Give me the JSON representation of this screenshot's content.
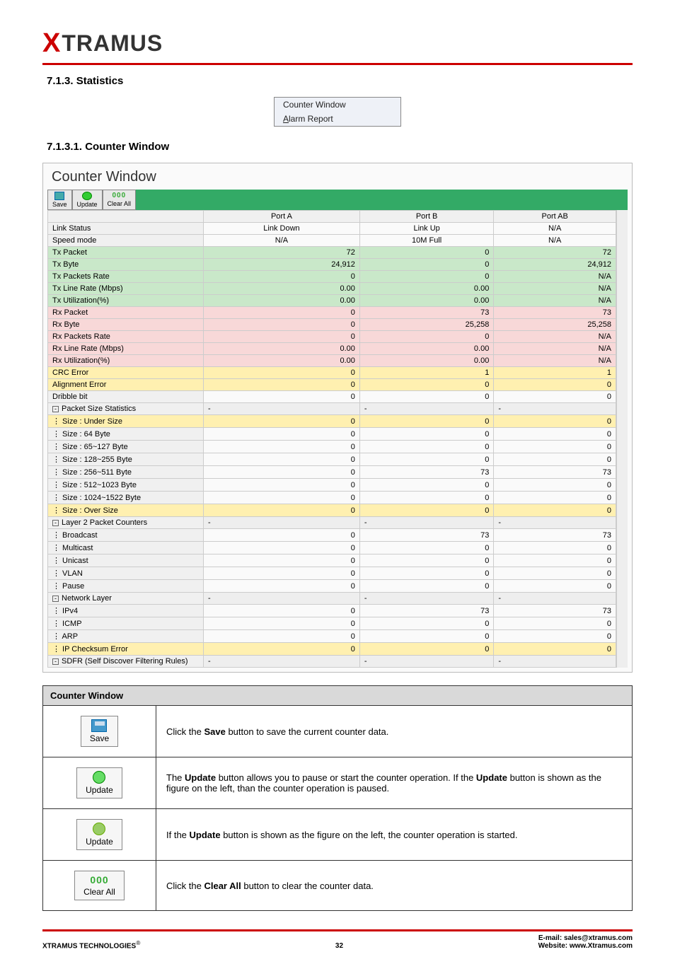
{
  "brand": {
    "x": "X",
    "name": "TRAMUS"
  },
  "section": {
    "num_title": "7.1.3. Statistics",
    "sub_title": "7.1.3.1. Counter Window"
  },
  "menu": {
    "item1": "Counter Window",
    "item2_u": "A",
    "item2_rest": "larm Report"
  },
  "cw": {
    "title": "Counter Window",
    "toolbar": {
      "save": "Save",
      "update": "Update",
      "clear": "Clear All"
    },
    "headers": {
      "blank": "",
      "a": "Port A",
      "b": "Port B",
      "ab": "Port AB"
    },
    "rows": [
      {
        "label": "Link Status",
        "a": "Link Down",
        "b": "Link Up",
        "ab": "N/A",
        "cls": ""
      },
      {
        "label": "Speed mode",
        "a": "N/A",
        "b": "10M Full",
        "ab": "N/A",
        "cls": ""
      },
      {
        "label": "Tx Packet",
        "a": "72",
        "b": "0",
        "ab": "72",
        "cls": "row-green"
      },
      {
        "label": "Tx Byte",
        "a": "24,912",
        "b": "0",
        "ab": "24,912",
        "cls": "row-green"
      },
      {
        "label": "Tx Packets Rate",
        "a": "0",
        "b": "0",
        "ab": "N/A",
        "cls": "row-green"
      },
      {
        "label": "Tx Line Rate (Mbps)",
        "a": "0.00",
        "b": "0.00",
        "ab": "N/A",
        "cls": "row-green"
      },
      {
        "label": "Tx Utilization(%)",
        "a": "0.00",
        "b": "0.00",
        "ab": "N/A",
        "cls": "row-green"
      },
      {
        "label": "Rx Packet",
        "a": "0",
        "b": "73",
        "ab": "73",
        "cls": "row-pink"
      },
      {
        "label": "Rx Byte",
        "a": "0",
        "b": "25,258",
        "ab": "25,258",
        "cls": "row-pink"
      },
      {
        "label": "Rx Packets Rate",
        "a": "0",
        "b": "0",
        "ab": "N/A",
        "cls": "row-pink"
      },
      {
        "label": "Rx Line Rate (Mbps)",
        "a": "0.00",
        "b": "0.00",
        "ab": "N/A",
        "cls": "row-pink"
      },
      {
        "label": "Rx Utilization(%)",
        "a": "0.00",
        "b": "0.00",
        "ab": "N/A",
        "cls": "row-pink"
      },
      {
        "label": "CRC Error",
        "a": "0",
        "b": "1",
        "ab": "1",
        "cls": "row-err"
      },
      {
        "label": "Alignment Error",
        "a": "0",
        "b": "0",
        "ab": "0",
        "cls": "row-err"
      },
      {
        "label": "Dribble bit",
        "a": "0",
        "b": "0",
        "ab": "0",
        "cls": ""
      },
      {
        "label": "Packet Size Statistics",
        "a": "-",
        "b": "-",
        "ab": "-",
        "cls": "row-group",
        "group": true
      },
      {
        "label": "⋮ Size : Under Size",
        "a": "0",
        "b": "0",
        "ab": "0",
        "cls": "row-err"
      },
      {
        "label": "⋮ Size : 64 Byte",
        "a": "0",
        "b": "0",
        "ab": "0",
        "cls": ""
      },
      {
        "label": "⋮ Size : 65~127 Byte",
        "a": "0",
        "b": "0",
        "ab": "0",
        "cls": ""
      },
      {
        "label": "⋮ Size : 128~255 Byte",
        "a": "0",
        "b": "0",
        "ab": "0",
        "cls": ""
      },
      {
        "label": "⋮ Size : 256~511 Byte",
        "a": "0",
        "b": "73",
        "ab": "73",
        "cls": ""
      },
      {
        "label": "⋮ Size : 512~1023 Byte",
        "a": "0",
        "b": "0",
        "ab": "0",
        "cls": ""
      },
      {
        "label": "⋮ Size : 1024~1522 Byte",
        "a": "0",
        "b": "0",
        "ab": "0",
        "cls": ""
      },
      {
        "label": "⋮ Size : Over Size",
        "a": "0",
        "b": "0",
        "ab": "0",
        "cls": "row-err"
      },
      {
        "label": "Layer 2 Packet Counters",
        "a": "-",
        "b": "-",
        "ab": "-",
        "cls": "row-group",
        "group": true
      },
      {
        "label": "⋮ Broadcast",
        "a": "0",
        "b": "73",
        "ab": "73",
        "cls": ""
      },
      {
        "label": "⋮ Multicast",
        "a": "0",
        "b": "0",
        "ab": "0",
        "cls": ""
      },
      {
        "label": "⋮ Unicast",
        "a": "0",
        "b": "0",
        "ab": "0",
        "cls": ""
      },
      {
        "label": "⋮ VLAN",
        "a": "0",
        "b": "0",
        "ab": "0",
        "cls": ""
      },
      {
        "label": "⋮ Pause",
        "a": "0",
        "b": "0",
        "ab": "0",
        "cls": ""
      },
      {
        "label": "Network Layer",
        "a": "-",
        "b": "-",
        "ab": "-",
        "cls": "row-group",
        "group": true
      },
      {
        "label": "⋮ IPv4",
        "a": "0",
        "b": "73",
        "ab": "73",
        "cls": ""
      },
      {
        "label": "⋮ ICMP",
        "a": "0",
        "b": "0",
        "ab": "0",
        "cls": ""
      },
      {
        "label": "⋮ ARP",
        "a": "0",
        "b": "0",
        "ab": "0",
        "cls": ""
      },
      {
        "label": "⋮ IP Checksum Error",
        "a": "0",
        "b": "0",
        "ab": "0",
        "cls": "row-err"
      },
      {
        "label": "SDFR (Self Discover Filtering Rules)",
        "a": "-",
        "b": "-",
        "ab": "-",
        "cls": "row-group",
        "group": true
      }
    ]
  },
  "info": {
    "header": "Counter Window",
    "rows": [
      {
        "icon": "save",
        "label": "Save",
        "desc_parts": [
          "Click the ",
          "Save",
          " button to save the current counter data."
        ]
      },
      {
        "icon": "update-green",
        "label": "Update",
        "desc_parts": [
          "The ",
          "Update",
          " button allows you to pause or start the counter operation. If the ",
          "Update",
          " button is shown as the figure on the left, than the counter operation is paused."
        ]
      },
      {
        "icon": "update-olive",
        "label": "Update",
        "desc_parts": [
          "If the ",
          "Update",
          " button is shown as the figure on the left, the counter operation is started."
        ]
      },
      {
        "icon": "clear",
        "label": "Clear All",
        "label_top": "000",
        "desc_parts": [
          "Click the ",
          "Clear All",
          " button to clear the counter data."
        ]
      }
    ]
  },
  "footer": {
    "left": "XTRAMUS TECHNOLOGIES",
    "reg": "®",
    "page": "32",
    "email_label": "E-mail: ",
    "email": "sales@xtramus.com",
    "site_label": "Website:  ",
    "site": "www.Xtramus.com"
  }
}
